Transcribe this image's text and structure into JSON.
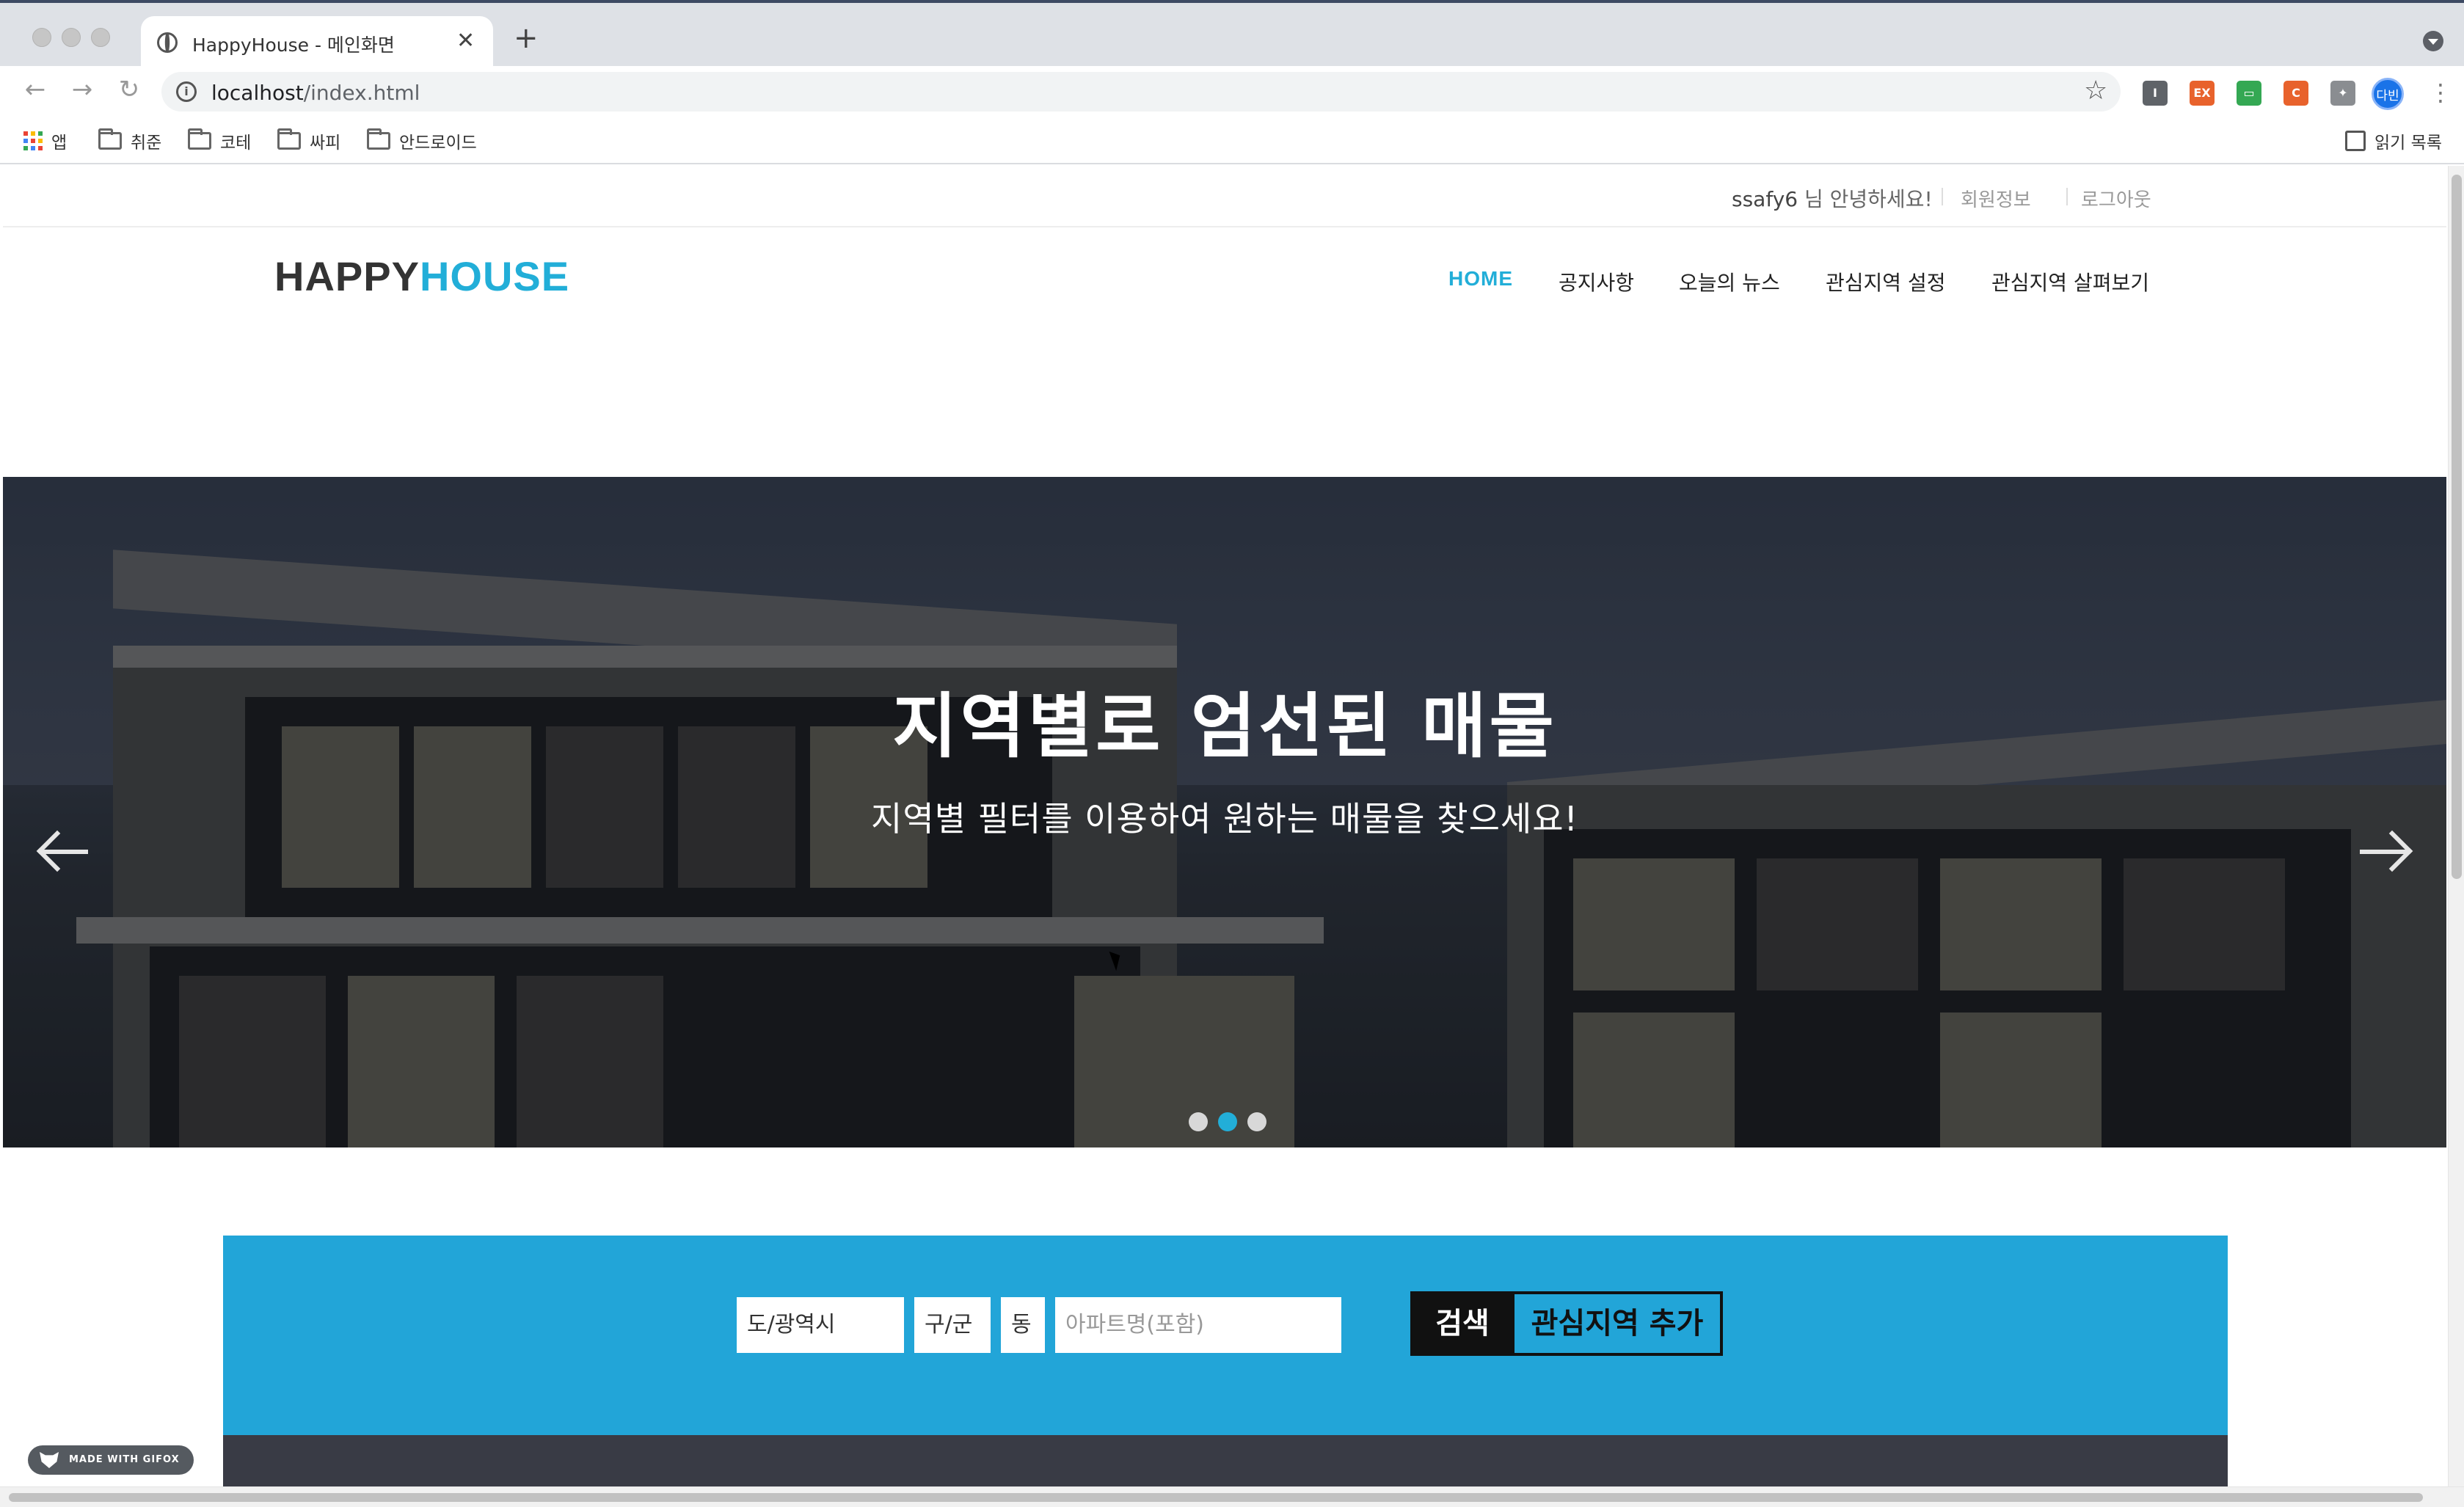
{
  "browser": {
    "tab_title": "HappyHouse - 메인화면",
    "tab_close": "✕",
    "new_tab": "+",
    "url_host": "localhost",
    "url_path": "/index.html",
    "nav_back": "←",
    "nav_forward": "→",
    "nav_reload": "↻",
    "star": "☆",
    "profile_label": "다빈",
    "kebab": "⋮",
    "extensions": [
      {
        "name": "ext-i-icon",
        "label": "I",
        "color": "#5f6368"
      },
      {
        "name": "ext-ex-icon",
        "label": "EX",
        "color": "#e8622c"
      },
      {
        "name": "ext-screen-icon",
        "label": "▭",
        "color": "#34a853"
      },
      {
        "name": "ext-c-icon",
        "label": "C",
        "color": "#e8622c"
      },
      {
        "name": "puzzle-icon",
        "label": "✦",
        "color": "#8a8d91"
      }
    ],
    "bookmarks": [
      "앱",
      "취준",
      "코테",
      "싸피",
      "안드로이드"
    ],
    "reading_list": "읽기 목록"
  },
  "site": {
    "greeting_user": "ssafy6",
    "greeting_text": " 님 안녕하세요!",
    "member_info": "회원정보",
    "logout": "로그아웃",
    "logo_part1": "HAPPY",
    "logo_part2": "HOUSE",
    "menu": [
      "HOME",
      "공지사항",
      "오늘의 뉴스",
      "관심지역 설정",
      "관심지역 살펴보기"
    ],
    "active_menu": "HOME"
  },
  "hero": {
    "title": "지역별로 엄선된 매물",
    "subtitle": "지역별 필터를 이용하여 원하는 매물을 찾으세요!",
    "slide_count": 3,
    "active_slide": 2
  },
  "search": {
    "sido": "도/광역시",
    "gugun": "구/군",
    "dong": "동",
    "apt_placeholder": "아파트명(포함)",
    "search_button": "검색",
    "add_button": "관심지역 추가"
  },
  "watermark": "MADE WITH GIFOX",
  "colors": {
    "accent": "#22aed8",
    "panel": "#22a5d8",
    "dark": "#393b45"
  }
}
